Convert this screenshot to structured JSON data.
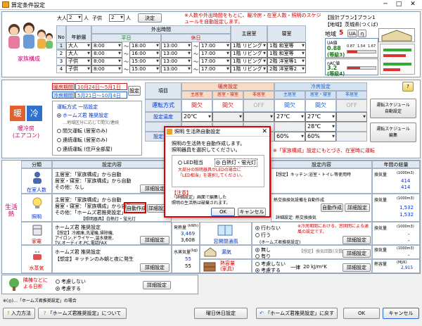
{
  "window": {
    "title": "算定条件設定",
    "min": "─",
    "max": "□",
    "close": "✕"
  },
  "family": {
    "adults_label": "大人",
    "adults_value": "2",
    "kids_label": "子供",
    "kids_value": "2",
    "unit": "人",
    "decide": "決定",
    "note": "※人数や外出時間をもとに、暖冷房・在室人数・照明のスケジュールを自動設定します。",
    "section_label": "家族構成",
    "head_no": "No",
    "head_age": "年齢層",
    "head_out": "外出時間",
    "head_weekday": "平日",
    "head_holiday": "休日",
    "head_main": "主居室",
    "head_bed": "寝室",
    "rows": [
      {
        "no": "1",
        "age": "大人",
        "w1": "8:00",
        "w2": "18:00",
        "h1": "13:00",
        "h2": "17:00",
        "main": "1階 リビング",
        "bed": "1階 和室等"
      },
      {
        "no": "2",
        "age": "大人",
        "w1": "8:00",
        "w2": "16:00",
        "h1": "13:00",
        "h2": "17:00",
        "main": "1階 リビング",
        "bed": "1階 和室等"
      },
      {
        "no": "3",
        "age": "子供",
        "w1": "8:00",
        "w2": "15:00",
        "h1": "13:00",
        "h2": "17:00",
        "main": "1階 リビング",
        "bed": "2階 洋室等1"
      },
      {
        "no": "4",
        "age": "子供",
        "w1": "8:00",
        "w2": "15:00",
        "h1": "13:00",
        "h2": "17:00",
        "main": "1階 リビング",
        "bed": "2階 洋室等2"
      }
    ],
    "tilde": "～"
  },
  "plan": {
    "plan_label": "【設計プラン】",
    "plan_value": "プラン1",
    "area_label": "【地域】",
    "area_value": "茨城県(つくば)",
    "region_label": "地域",
    "region_value": "5",
    "ua_btn": "UA",
    "eta_btn": "η",
    "ua_title": "UA値",
    "ua_value": "0.88",
    "ua_grade": "(等級3)",
    "ua_scale": [
      "0.87",
      "1.54",
      "1.67"
    ],
    "eta_title": "ηAC値",
    "eta_value": "3.2",
    "eta_grade": "(等級4)",
    "ua_fill": 0.35,
    "eta_fill": 0.45
  },
  "hvac": {
    "section_label": "暖冷房\n(エアコン)",
    "heat_glyph": "暖",
    "cool_glyph": "冷",
    "heat_period_label": "暖房期間",
    "heat_period": "10月24日～5月1日",
    "cool_period_label": "冷房期間",
    "cool_period": "5月21日～10月4日",
    "set_btn": "設定",
    "mode_title": "運転方式 一括設定",
    "modes": [
      {
        "label": "ホームズ君 推奨設定",
        "checked": true
      },
      {
        "label": "間欠運転 (居室のみ)",
        "checked": false
      },
      {
        "label": "連続運転 (居室のみ)",
        "checked": false
      },
      {
        "label": "連続運転 (住戸全部屋)",
        "checked": false
      }
    ],
    "mode_sub": "…地域区分に応じて間欠/連続",
    "item_head": "項目",
    "heat_head": "暖房設定",
    "cool_head": "冷房設定",
    "cols": [
      "主居室",
      "居室・寝室",
      "非居室",
      "主居室",
      "居室・寝室",
      "非居室"
    ],
    "row_mode": "運転方式",
    "row_temp": "設定温度",
    "row_hum": "設定湿度",
    "modes_row": [
      "間欠",
      "間欠",
      "OFF",
      "間欠",
      "間欠",
      "OFF"
    ],
    "temps_row": [
      "20℃",
      "",
      "",
      "27℃",
      "27℃",
      ""
    ],
    "cool_temp2": "28℃",
    "hum_row": [
      "60%",
      "60%"
    ],
    "note": "※「家族構成」設定にもとづき、在室時に運転",
    "help_btn": "?",
    "sched_btn": "運転スケジュール\n自動設定",
    "sched_edit_btn": "運転スケジュール\n編集"
  },
  "dialog": {
    "title": "照明 生活熱自動設定",
    "msg1": "照明の生活熱を自動作成します。",
    "msg2": "照明器具を選択してください。",
    "opt1": "LED相当",
    "opt2": "白熱灯・蛍光灯",
    "warn": "大部分の照明器具がLEDの場合に\n「LED相当」を選択してください。",
    "note_title": "【注意】",
    "note_body": "「詳細設定」画面で編集した\n照明の生活熱は破棄されます。",
    "ok": "OK",
    "cancel": "キャンセル"
  },
  "life": {
    "section_label": "生活熱",
    "head_class": "分類",
    "head_content": "設定内容",
    "head_sum": "年間の総量",
    "rows": [
      {
        "name": "在室人数",
        "l1": "主居室：「家族構成」から自動",
        "l2": "居室・寝室：「家族構成」から自動",
        "l3": "その他：なし",
        "btn": "詳細設定"
      },
      {
        "name": "照明",
        "l1": "主居室：「家族構成」から自動",
        "l2": "居室・寝室：「家族構成」から自動",
        "l3": "その他：「ホームズ君推奨設定」",
        "btn_auto": "自動作成",
        "btn": "詳細設定",
        "sub": "【照明器具】白熱灯・蛍光灯"
      },
      {
        "name": "家電",
        "l1": "ホームズ君 推奨設定",
        "l2": "【想定】冷蔵庫,洗濯機,掃除機,",
        "l3": "アイロン,ドライヤー,温水便座,",
        "l4": "TV,オーディオ,PC,電話FAX",
        "btn": "詳細設定",
        "sum_label": "発熱量",
        "sum_unit": "(kWh)",
        "sum1": "3,469",
        "sum2": "3,608"
      },
      {
        "name": "水蒸気",
        "l1": "ホームズ君 推奨設定",
        "l2": "【想定】キッチンのみ朝と夜に発生",
        "btn": "詳細設定",
        "sum_label": "水蒸気量",
        "sum_unit": "(kg)",
        "sum1": "55",
        "sum2": "55"
      }
    ],
    "vent_head": "設定内容",
    "vent_sum": "年間の総量",
    "vent_rows": [
      {
        "l1": "【想定】キッチン:浴室・トイレ等使用時",
        "sum_label": "換気量",
        "sum_unit": "(1000m3)",
        "sum1": "414",
        "sum2": "414"
      },
      {
        "l1": "熱交換換気設備を自動作成",
        "btn": "自動作成",
        "btn2": "詳細設定",
        "l2": "詳細設定: 熱交換換気",
        "sum_label": "換気量",
        "sum_unit": "(1000m3)",
        "sum1": "1,532",
        "sum2": "1,532"
      },
      {
        "name": "窓開閉通風",
        "o1": "行わない",
        "o2": "行う",
        "o3": "(ホームズ君推奨設定)",
        "note": "※冷房期間における、窓開閉による通風の設定です。",
        "btn": "詳細設定",
        "sum_label": "換気量",
        "sum_unit": "(1000m3)",
        "sum1": "-",
        "sum2": "-"
      },
      {
        "name": "漏気",
        "o1": "無し",
        "o2": "有り",
        "l1": "【想定】換気回数(次数)",
        "btn": "詳細設定",
        "sum_label": "換気量",
        "sum_unit": "(1000m3)",
        "sum1": "-",
        "sum2": "-"
      },
      {
        "name": "熱容量\n(家具)",
        "o1": "考慮しない",
        "o2": "考慮する",
        "l1": "一律",
        "l2": "20 kJ/m²K",
        "btn": "詳細設定",
        "sum_label": "熱容量",
        "sum_unit": "(MJ/K)",
        "sum1": "2,915",
        "sum2": "2,915"
      }
    ]
  },
  "neighbor": {
    "name": "隣棟などによる日影",
    "o1": "考慮しない",
    "o2": "考慮する",
    "btn": "詳細設定"
  },
  "footer": {
    "note": "※(◎)…「ホームズ君推奨設定」の場合",
    "input_btn": "入力方法",
    "about_btn": "「ホームズ君推奨設定」について",
    "holiday_btn": "曜日休日設定",
    "back_btn": "「ホームズ君推奨設定」に戻す",
    "ok_btn": "OK",
    "cancel_btn": "キャンセル"
  },
  "colors": {
    "accent": "#d0006a",
    "heat": "#d64a1a",
    "cool": "#1a5fc8",
    "alert": "#e00000"
  }
}
